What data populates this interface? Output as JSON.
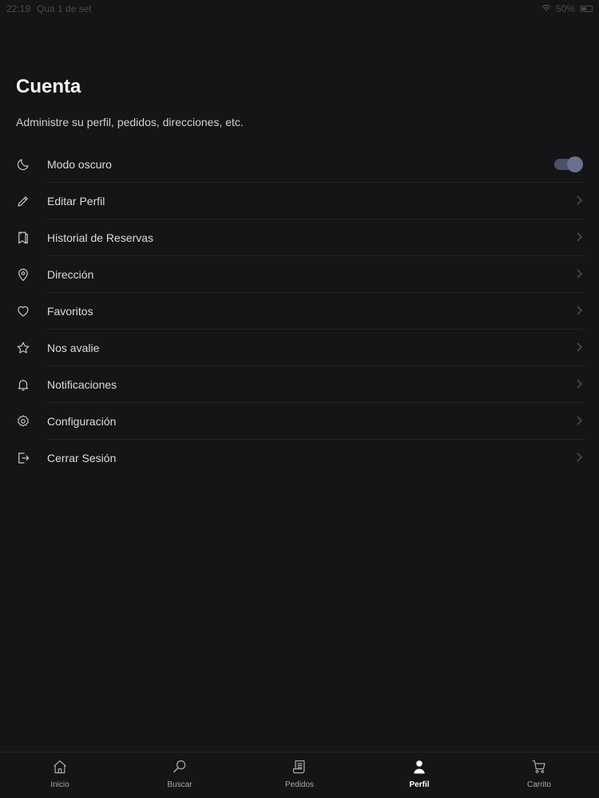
{
  "status_bar": {
    "time": "22:19",
    "date": "Qua 1 de set",
    "battery": "50%"
  },
  "header": {
    "title": "Cuenta",
    "subtitle": "Administre su perfil, pedidos, direcciones, etc."
  },
  "menu": {
    "items": [
      {
        "label": "Modo oscuro",
        "icon": "moon-icon",
        "toggle": true,
        "toggle_on": true
      },
      {
        "label": "Editar Perfil",
        "icon": "pencil-icon"
      },
      {
        "label": "Historial de Reservas",
        "icon": "bookmark-icon"
      },
      {
        "label": "Dirección",
        "icon": "location-pin-icon"
      },
      {
        "label": "Favoritos",
        "icon": "heart-icon"
      },
      {
        "label": "Nos avalie",
        "icon": "star-icon"
      },
      {
        "label": "Notificaciones",
        "icon": "bell-icon"
      },
      {
        "label": "Configuración",
        "icon": "gear-icon"
      },
      {
        "label": "Cerrar Sesión",
        "icon": "logout-icon"
      }
    ]
  },
  "tab_bar": {
    "tabs": [
      {
        "label": "Inicio",
        "icon": "home-icon",
        "active": false
      },
      {
        "label": "Buscar",
        "icon": "search-icon",
        "active": false
      },
      {
        "label": "Pedidos",
        "icon": "receipt-icon",
        "active": false
      },
      {
        "label": "Perfil",
        "icon": "user-icon",
        "active": true
      },
      {
        "label": "Carrito",
        "icon": "cart-icon",
        "active": false
      }
    ]
  },
  "colors": {
    "background": "#151517",
    "divider": "#26262a",
    "toggle_track": "#4c5066",
    "toggle_knob": "#6a7090"
  }
}
